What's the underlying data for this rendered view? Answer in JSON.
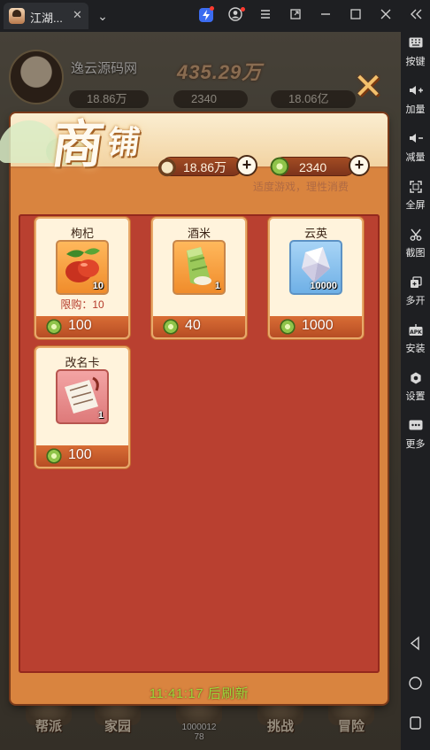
{
  "window": {
    "tab_title": "江湖...",
    "tab_close": "✕",
    "chevron": "⌄",
    "buttons": [
      "boost-icon",
      "account-icon",
      "menu-icon",
      "restore-icon",
      "minimize-icon",
      "maximize-icon",
      "close-icon",
      "collapse-icon"
    ]
  },
  "sidebar": {
    "items": [
      {
        "label": "按键",
        "icon": "keyboard-icon"
      },
      {
        "label": "加量",
        "icon": "volume-up-icon"
      },
      {
        "label": "减量",
        "icon": "volume-down-icon"
      },
      {
        "label": "全屏",
        "icon": "fullscreen-icon"
      },
      {
        "label": "截图",
        "icon": "scissors-icon"
      },
      {
        "label": "多开",
        "icon": "multi-instance-icon"
      },
      {
        "label": "安装",
        "icon": "apk-icon"
      },
      {
        "label": "设置",
        "icon": "gear-icon"
      },
      {
        "label": "更多",
        "icon": "more-icon"
      }
    ],
    "nav": [
      "back-icon",
      "home-icon",
      "recents-icon"
    ]
  },
  "background_hud": {
    "player_name": "逸云源码网",
    "power": "435.29万",
    "res_silver": "18.86万",
    "res_jade": "2340",
    "res_other": "18.06亿",
    "nav": [
      {
        "label": "帮派"
      },
      {
        "label": "家园"
      },
      {
        "label": ""
      },
      {
        "label": "挑战"
      },
      {
        "label": "冒险"
      }
    ],
    "center_number": "1000012",
    "center_number2": "78"
  },
  "shop": {
    "title_first": "商",
    "title_second": "铺",
    "silver": "18.86万",
    "jade": "2340",
    "tip": "适度游戏，理性消费",
    "items": [
      {
        "name": "枸杞",
        "qty": "10",
        "limit": "限购：10",
        "price": "100"
      },
      {
        "name": "酒米",
        "qty": "1",
        "limit": "",
        "price": "40"
      },
      {
        "name": "云英",
        "qty": "10000",
        "limit": "",
        "price": "1000"
      },
      {
        "name": "改名卡",
        "qty": "1",
        "limit": "",
        "price": "100"
      }
    ],
    "refresh_text": "11:41:17 后刷新"
  },
  "colors": {
    "panel_red": "#b94030",
    "panel_orange": "#d9843f",
    "refresh_green": "#9bd83a",
    "header_cream": "#fbeed1"
  }
}
